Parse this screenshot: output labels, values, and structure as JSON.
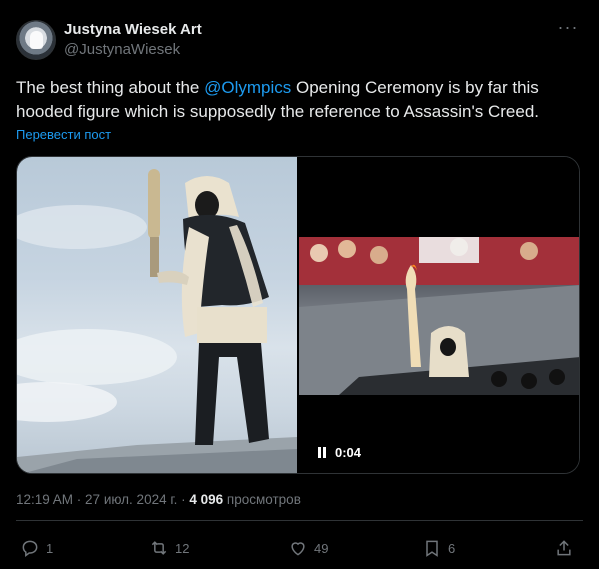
{
  "author": {
    "name": "Justyna Wiesek Art",
    "handle": "@JustynaWiesek"
  },
  "icons": {
    "more": "more-options-icon",
    "reply": "reply-icon",
    "retweet": "retweet-icon",
    "like": "heart-icon",
    "bookmark": "bookmark-icon",
    "share": "share-icon",
    "pause": "pause-icon"
  },
  "tweet": {
    "text_before": "The best thing about the ",
    "mention": "@Olympics",
    "text_after": " Opening Ceremony is by far this hooded figure which is supposedly the reference to Assassin's Creed.",
    "translate_label": "Перевести пост"
  },
  "media": {
    "video_time": "0:04"
  },
  "meta": {
    "time": "12:19 AM",
    "separator": " · ",
    "date": "27 июл. 2024 г.",
    "separator2": " · ",
    "views_count": "4 096",
    "views_label": " просмотров"
  },
  "actions": {
    "replies": "1",
    "retweets": "12",
    "likes": "49",
    "bookmarks": "6"
  },
  "colors": {
    "background": "#000000",
    "text": "#e7e9ea",
    "secondary": "#71767b",
    "accent": "#1d9bf0",
    "border": "#2f3336"
  }
}
